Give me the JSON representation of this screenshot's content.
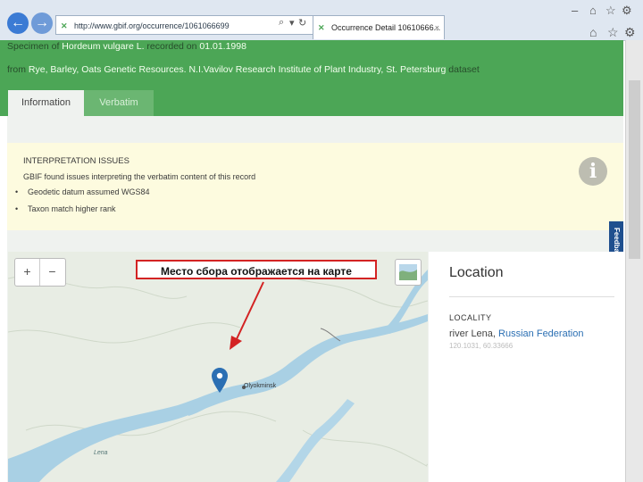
{
  "browser": {
    "address": "http://www.gbif.org/occurrence/1061066699",
    "tab_title": "Occurrence Detail 10610666..."
  },
  "header": {
    "line1": {
      "pre": "Specimen of ",
      "species": "Hordeum vulgare L.",
      "mid": " recorded on ",
      "date": "01.01.1998"
    },
    "line2": {
      "pre": "from ",
      "dataset": "Rye, Barley, Oats Genetic Resources. N.I.Vavilov Research Institute of Plant Industry, St. Petersburg",
      "post": " dataset"
    }
  },
  "tabs": [
    {
      "label": "Information",
      "active": true
    },
    {
      "label": "Verbatim",
      "active": false
    }
  ],
  "issues": {
    "title": "INTERPRETATION ISSUES",
    "description": "GBIF found issues interpreting the verbatim content of this record",
    "items": [
      "Geodetic datum assumed WGS84",
      "Taxon match higher rank"
    ]
  },
  "feedback": "Feedback",
  "map": {
    "zoom_in": "+",
    "zoom_out": "−",
    "annotation": "Место сбора отображается на карте",
    "place_label": "Olyokminsk",
    "river_label": "Lena"
  },
  "location": {
    "title": "Location",
    "locality_label": "LOCALITY",
    "locality_value": "river Lena,",
    "country": "Russian Federation",
    "coords": "120.1031, 60.33666"
  },
  "colors": {
    "header_green": "#4ca656",
    "issues_bg": "#fdfbdf",
    "annotation_border": "#d32323",
    "marker": "#2b6fb3"
  }
}
